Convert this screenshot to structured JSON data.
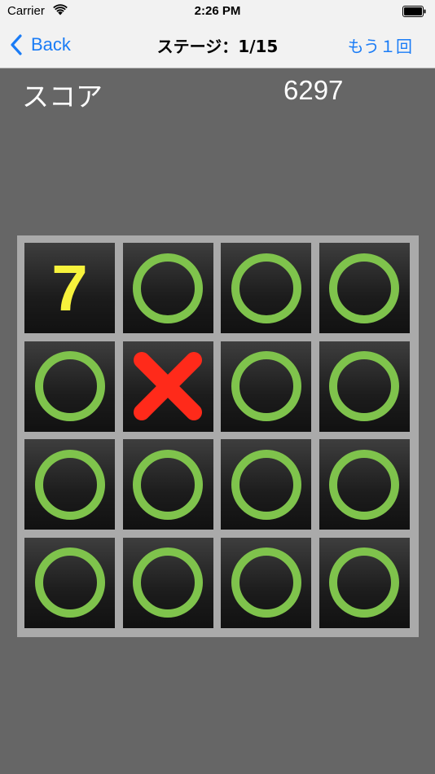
{
  "status_bar": {
    "carrier": "Carrier",
    "time": "2:26 PM",
    "icons": [
      "wifi-icon",
      "battery-icon"
    ]
  },
  "nav": {
    "back_label": "Back",
    "title": "ステージ：1/15",
    "retry_label": "もう１回"
  },
  "score": {
    "label": "スコア",
    "value": "6297"
  },
  "colors": {
    "accent": "#1a7cf6",
    "circle": "#7fc34c",
    "cross": "#ff2a1a",
    "number": "#f7f23c",
    "background": "#666666"
  },
  "board": {
    "rows": 4,
    "cols": 4,
    "cells": [
      {
        "type": "number",
        "value": "7"
      },
      {
        "type": "circle"
      },
      {
        "type": "circle"
      },
      {
        "type": "circle"
      },
      {
        "type": "circle"
      },
      {
        "type": "cross"
      },
      {
        "type": "circle"
      },
      {
        "type": "circle"
      },
      {
        "type": "circle"
      },
      {
        "type": "circle"
      },
      {
        "type": "circle"
      },
      {
        "type": "circle"
      },
      {
        "type": "circle"
      },
      {
        "type": "circle"
      },
      {
        "type": "circle"
      },
      {
        "type": "circle"
      }
    ]
  }
}
